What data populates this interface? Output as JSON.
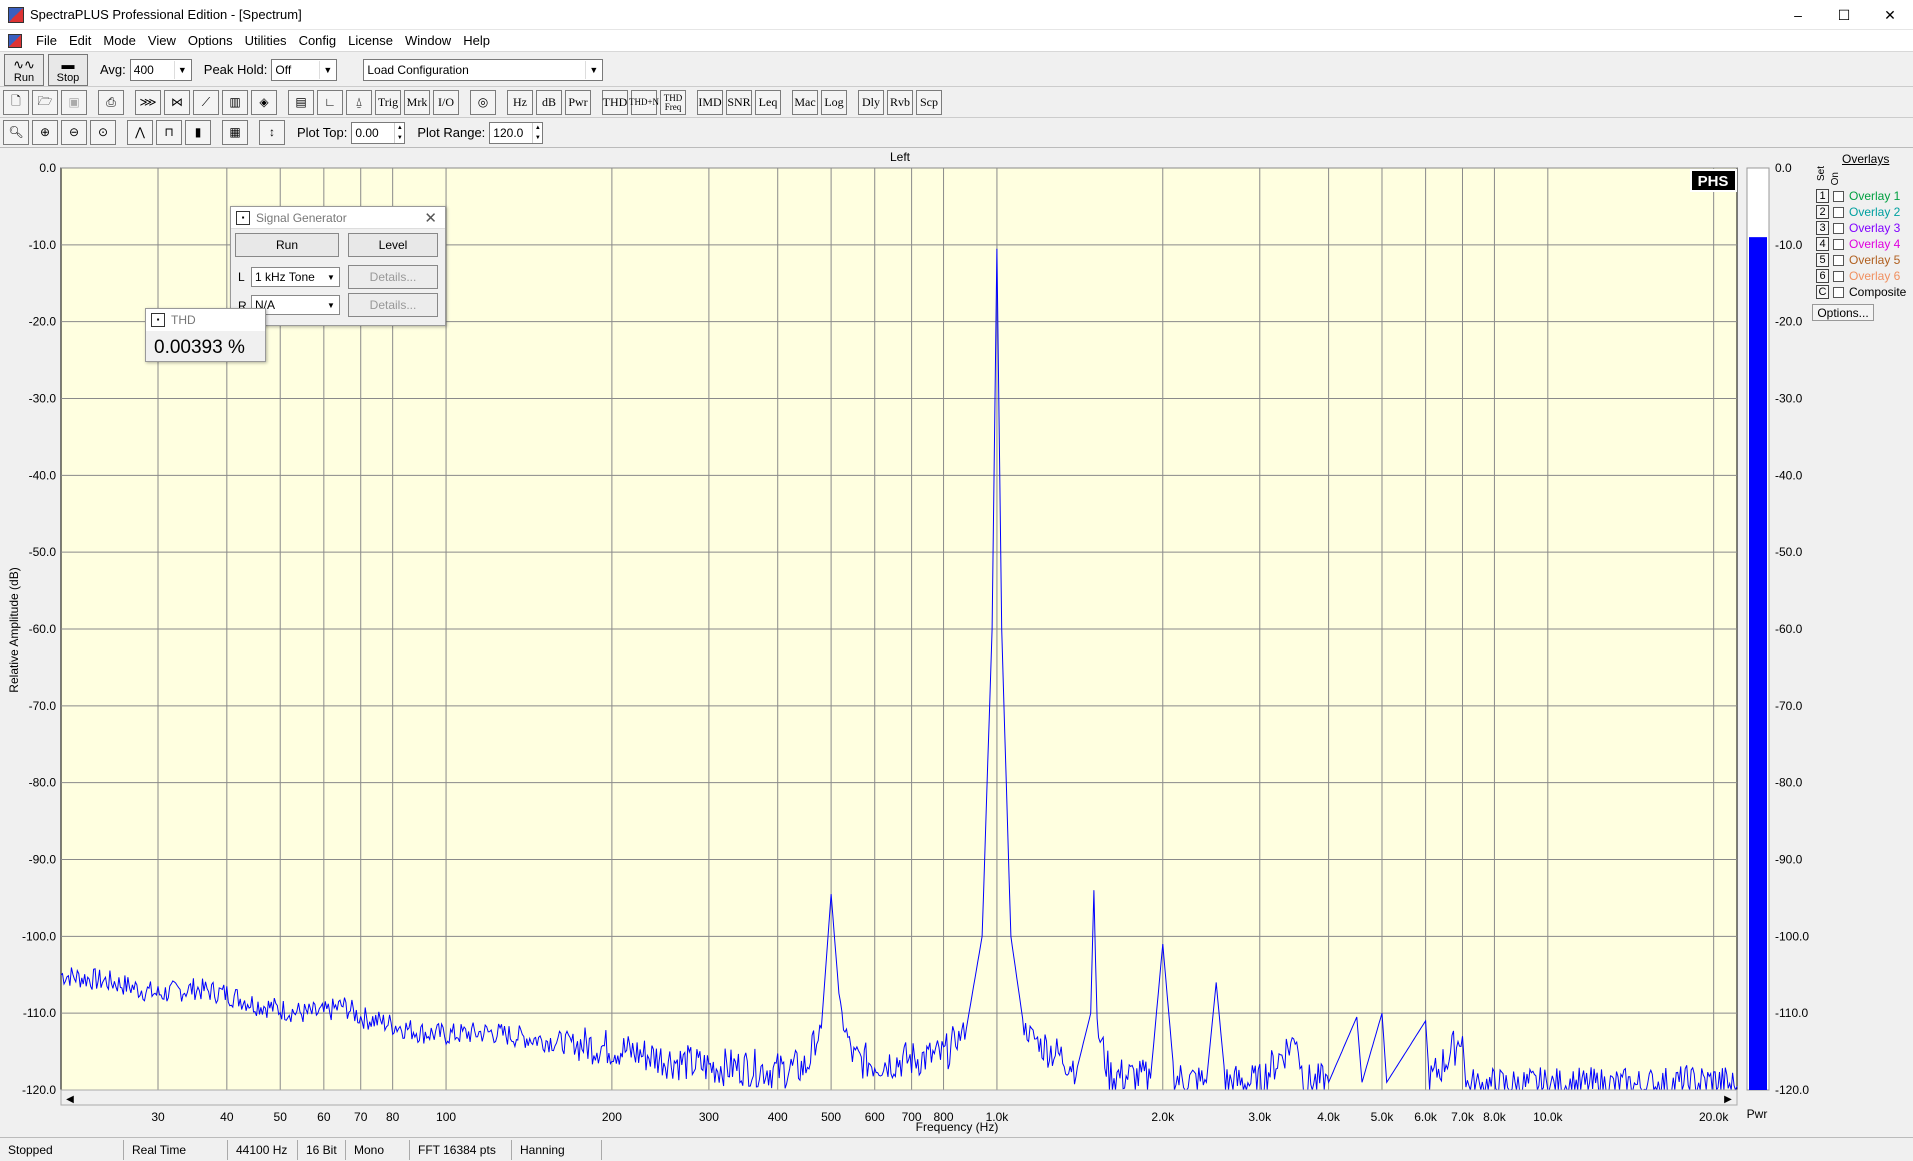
{
  "window": {
    "title": "SpectraPLUS Professional Edition - [Spectrum]",
    "controls": [
      "–",
      "☐",
      "✕"
    ]
  },
  "menu": [
    "File",
    "Edit",
    "Mode",
    "View",
    "Options",
    "Utilities",
    "Config",
    "License",
    "Window",
    "Help"
  ],
  "toolbar1": {
    "run_label": "Run",
    "stop_label": "Stop",
    "avg_label": "Avg:",
    "avg_value": "400",
    "peak_hold_label": "Peak Hold:",
    "peak_hold_value": "Off",
    "config_value": "Load Configuration"
  },
  "toolbar2": {
    "text_buttons": [
      "Trig",
      "Mrk",
      "I/O",
      "Hz",
      "dB",
      "Pwr",
      "THD",
      "THD+N",
      "THD Freq",
      "IMD",
      "SNR",
      "Leq",
      "Mac",
      "Log",
      "Dly",
      "Rvb",
      "Scp"
    ]
  },
  "toolbar3": {
    "plot_top_label": "Plot Top:",
    "plot_top_value": "0.00",
    "plot_range_label": "Plot Range:",
    "plot_range_value": "120.0"
  },
  "plot": {
    "channel_title": "Left",
    "y_axis_label": "Relative Amplitude (dB)",
    "x_axis_label": "Frequency (Hz)",
    "logo": "PHS",
    "meter_label": "Pwr",
    "meter_level_db": -9.0,
    "colors": {
      "background": "#ffffe0",
      "trace": "#0000ff",
      "grid": "#808080",
      "meter": "#0000ff"
    }
  },
  "chart_data": {
    "type": "line",
    "title": "Left",
    "xlabel": "Frequency (Hz)",
    "ylabel": "Relative Amplitude (dB)",
    "x_scale": "log",
    "xlim": [
      20,
      22050
    ],
    "ylim": [
      -120,
      0
    ],
    "y_ticks": [
      "0.0",
      "-10.0",
      "-20.0",
      "-30.0",
      "-40.0",
      "-50.0",
      "-60.0",
      "-70.0",
      "-80.0",
      "-90.0",
      "-100.0",
      "-110.0",
      "-120.0"
    ],
    "x_ticks": [
      {
        "v": 30,
        "label": "30"
      },
      {
        "v": 40,
        "label": "40"
      },
      {
        "v": 50,
        "label": "50"
      },
      {
        "v": 60,
        "label": "60"
      },
      {
        "v": 70,
        "label": "70"
      },
      {
        "v": 80,
        "label": "80"
      },
      {
        "v": 100,
        "label": "100"
      },
      {
        "v": 200,
        "label": "200"
      },
      {
        "v": 300,
        "label": "300"
      },
      {
        "v": 400,
        "label": "400"
      },
      {
        "v": 500,
        "label": "500"
      },
      {
        "v": 600,
        "label": "600"
      },
      {
        "v": 700,
        "label": "700"
      },
      {
        "v": 800,
        "label": "800"
      },
      {
        "v": 1000,
        "label": "1.0k"
      },
      {
        "v": 2000,
        "label": "2.0k"
      },
      {
        "v": 3000,
        "label": "3.0k"
      },
      {
        "v": 4000,
        "label": "4.0k"
      },
      {
        "v": 5000,
        "label": "5.0k"
      },
      {
        "v": 6000,
        "label": "6.0k"
      },
      {
        "v": 7000,
        "label": "7.0k"
      },
      {
        "v": 8000,
        "label": "8.0k"
      },
      {
        "v": 10000,
        "label": "10.0k"
      },
      {
        "v": 20000,
        "label": "20.0k"
      }
    ],
    "grid": true,
    "series": [
      {
        "points": [
          [
            20,
            -105.0
          ],
          [
            25,
            -106.0
          ],
          [
            30,
            -107.5
          ],
          [
            35,
            -106.8
          ],
          [
            40,
            -107.5
          ],
          [
            45,
            -108.8
          ],
          [
            50,
            -109.5
          ],
          [
            55,
            -110.0
          ],
          [
            60,
            -110.0
          ],
          [
            65,
            -109.0
          ],
          [
            70,
            -110.5
          ],
          [
            75,
            -111.0
          ],
          [
            80,
            -111.5
          ],
          [
            90,
            -112.5
          ],
          [
            100,
            -112.8
          ],
          [
            120,
            -112.5
          ],
          [
            150,
            -113.5
          ],
          [
            200,
            -114.5
          ],
          [
            250,
            -116.0
          ],
          [
            300,
            -117.0
          ],
          [
            350,
            -117.0
          ],
          [
            400,
            -117.5
          ],
          [
            450,
            -117.0
          ],
          [
            480,
            -112.0
          ],
          [
            500,
            -94.5
          ],
          [
            520,
            -110.0
          ],
          [
            550,
            -116.0
          ],
          [
            600,
            -116.5
          ],
          [
            700,
            -116.0
          ],
          [
            800,
            -115.5
          ],
          [
            880,
            -112.0
          ],
          [
            940,
            -100.0
          ],
          [
            980,
            -60.0
          ],
          [
            1000,
            -10.5
          ],
          [
            1020,
            -60.0
          ],
          [
            1060,
            -100.0
          ],
          [
            1120,
            -112.0
          ],
          [
            1200,
            -114.0
          ],
          [
            1400,
            -117.0
          ],
          [
            1480,
            -110.0
          ],
          [
            1500,
            -94.0
          ],
          [
            1520,
            -112.0
          ],
          [
            1600,
            -118.0
          ],
          [
            1900,
            -118.5
          ],
          [
            2000,
            -101.0
          ],
          [
            2100,
            -118.5
          ],
          [
            2400,
            -119.0
          ],
          [
            2500,
            -106.0
          ],
          [
            2600,
            -119.0
          ],
          [
            3000,
            -119.0
          ],
          [
            3500,
            -113.0
          ],
          [
            3600,
            -119.0
          ],
          [
            4000,
            -119.0
          ],
          [
            4500,
            -110.5
          ],
          [
            4600,
            -119.0
          ],
          [
            5000,
            -110.0
          ],
          [
            5100,
            -119.0
          ],
          [
            6000,
            -111.0
          ],
          [
            6100,
            -119.0
          ],
          [
            7000,
            -113.0
          ],
          [
            7100,
            -119.5
          ],
          [
            10000,
            -119.5
          ],
          [
            15000,
            -119.5
          ],
          [
            20000,
            -119.0
          ],
          [
            22050,
            -119.5
          ]
        ]
      }
    ]
  },
  "overlays": {
    "header": "Overlays",
    "set_label": "Set",
    "on_label": "On",
    "items": [
      {
        "num": "1",
        "label": "Overlay 1",
        "color": "#00a040"
      },
      {
        "num": "2",
        "label": "Overlay 2",
        "color": "#00a0a0"
      },
      {
        "num": "3",
        "label": "Overlay 3",
        "color": "#8000ff"
      },
      {
        "num": "4",
        "label": "Overlay 4",
        "color": "#e000e0"
      },
      {
        "num": "5",
        "label": "Overlay 5",
        "color": "#b06020"
      },
      {
        "num": "6",
        "label": "Overlay 6",
        "color": "#f09060"
      },
      {
        "num": "C",
        "label": "Composite",
        "color": "#000000"
      }
    ],
    "options_label": "Options..."
  },
  "signal_generator": {
    "title": "Signal Generator",
    "run_label": "Run",
    "level_label": "Level",
    "left_label": "L",
    "left_value": "1 kHz Tone",
    "right_label": "R",
    "right_value": "N/A",
    "details_label": "Details..."
  },
  "thd_window": {
    "title": "THD",
    "value": "0.00393 %"
  },
  "status": [
    "Stopped",
    "Real Time",
    "44100 Hz",
    "16 Bit",
    "Mono",
    "FFT 16384 pts",
    "Hanning"
  ]
}
